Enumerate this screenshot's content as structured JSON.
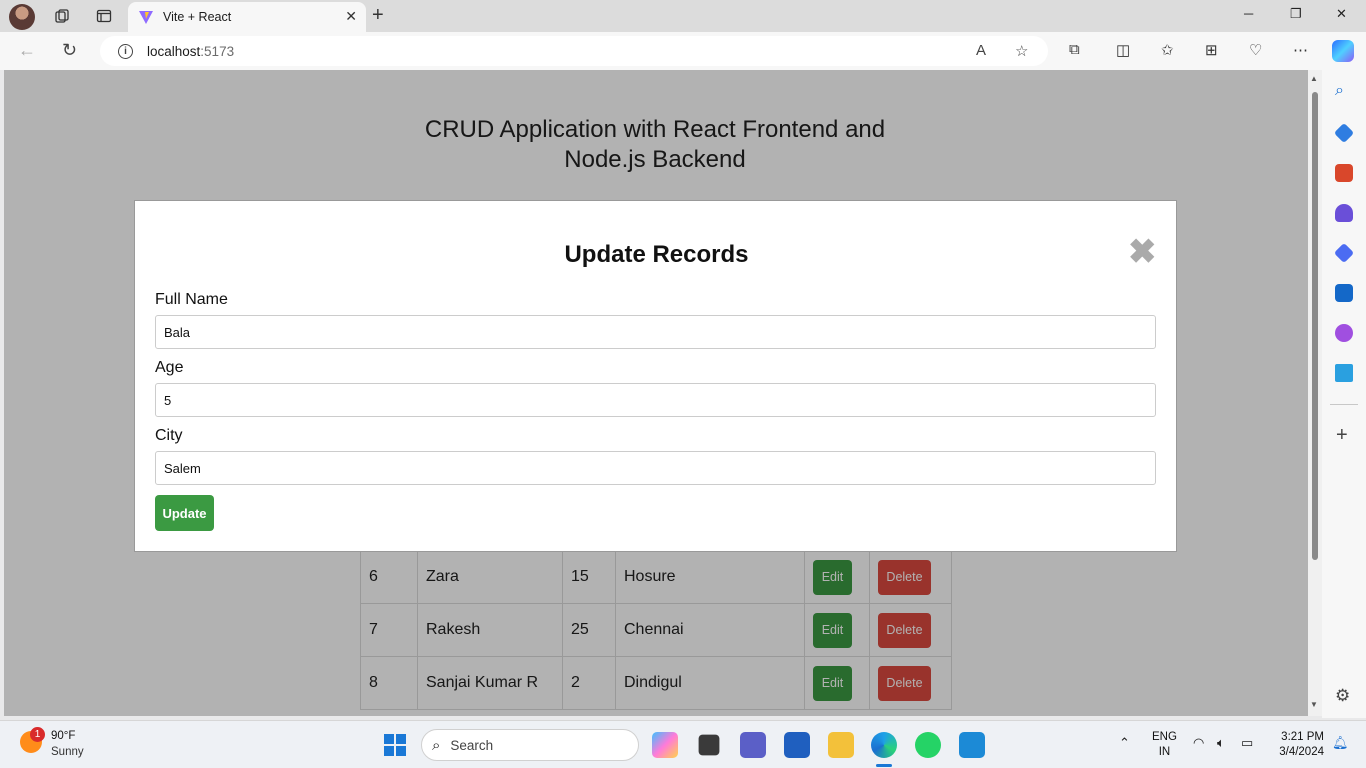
{
  "browser": {
    "tab_title": "Vite + React",
    "url_host": "localhost",
    "url_port": ":5173"
  },
  "page": {
    "title": "CRUD Application with React Frontend and Node.js Backend"
  },
  "table": {
    "rows": [
      {
        "id": "6",
        "name": "Zara",
        "age": "15",
        "city": "Hosure",
        "edit": "Edit",
        "delete": "Delete"
      },
      {
        "id": "7",
        "name": "Rakesh",
        "age": "25",
        "city": "Chennai",
        "edit": "Edit",
        "delete": "Delete"
      },
      {
        "id": "8",
        "name": "Sanjai Kumar R",
        "age": "2",
        "city": "Dindigul",
        "edit": "Edit",
        "delete": "Delete"
      }
    ]
  },
  "modal": {
    "title": "Update Records",
    "close": "✖",
    "fields": [
      {
        "label": "Full Name",
        "value": "Bala"
      },
      {
        "label": "Age",
        "value": "5"
      },
      {
        "label": "City",
        "value": "Salem"
      }
    ],
    "submit": "Update"
  },
  "taskbar": {
    "weather_temp": "90°F",
    "weather_cond": "Sunny",
    "weather_badge": "1",
    "search": "Search",
    "lang_line1": "ENG",
    "lang_line2": "IN",
    "time": "3:21 PM",
    "date": "3/4/2024"
  },
  "colors": {
    "primary_green": "#3b9a42",
    "delete_red": "#dc4a3f"
  }
}
